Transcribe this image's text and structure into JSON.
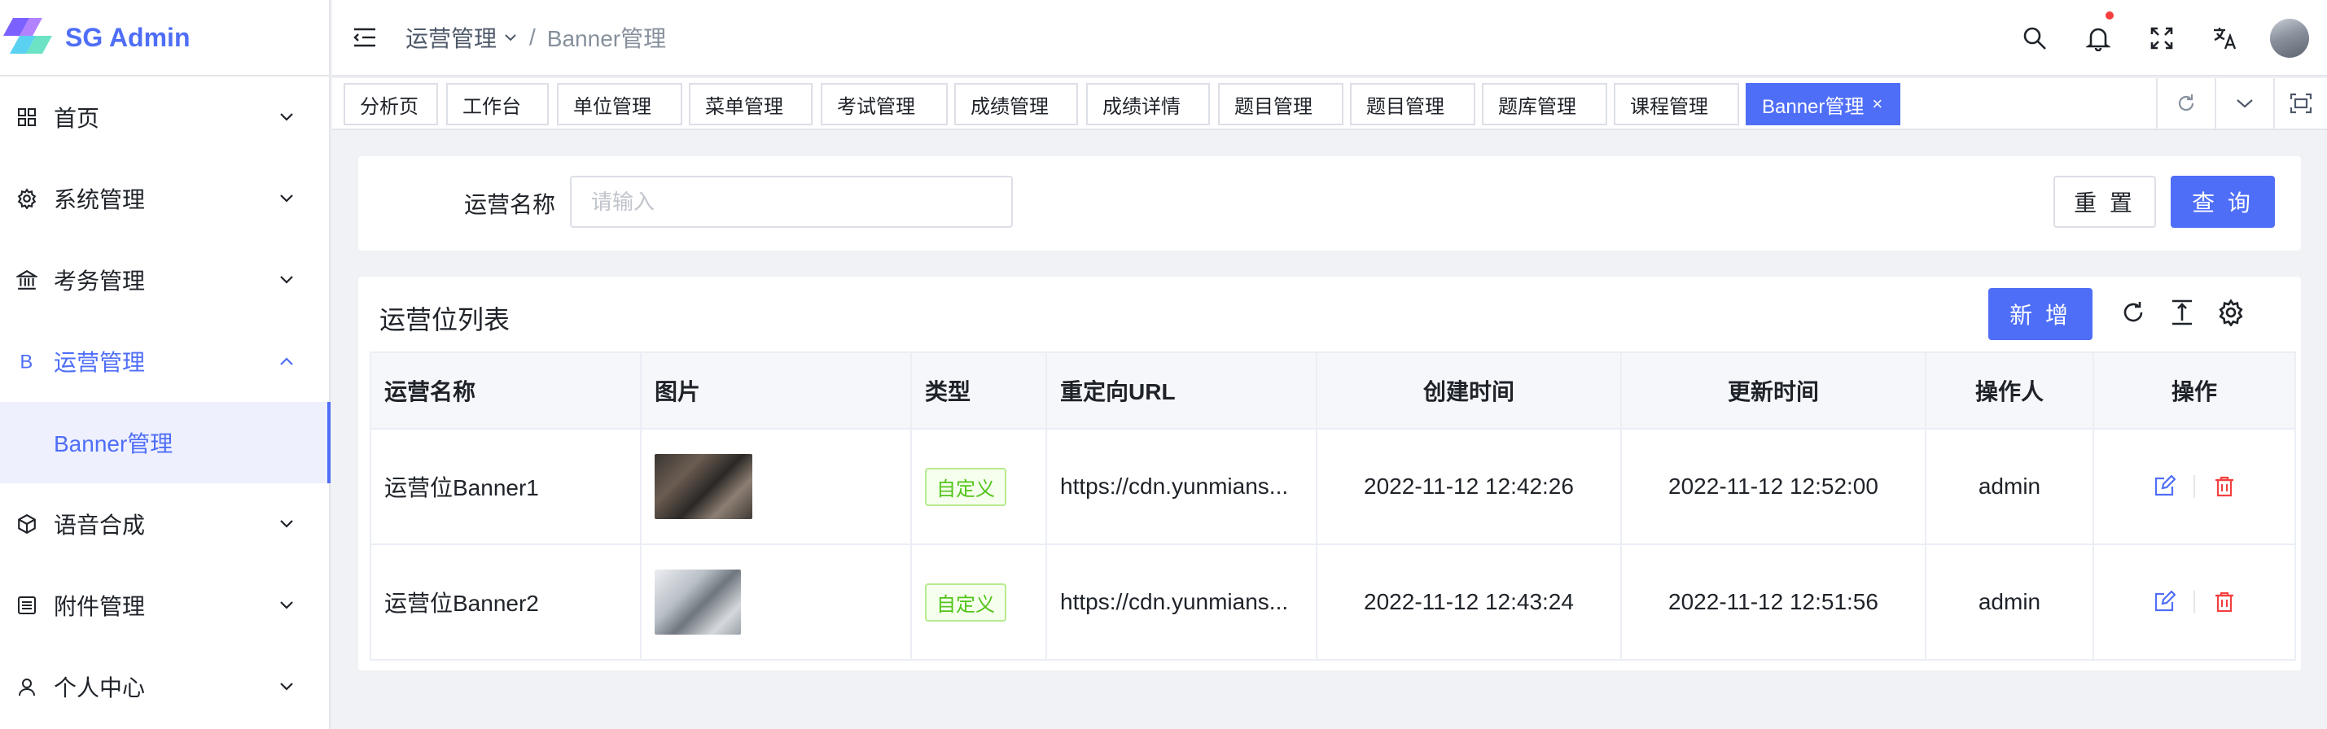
{
  "app": {
    "name": "SG Admin"
  },
  "sidebar": {
    "items": [
      {
        "label": "首页",
        "icon": "dashboard-icon"
      },
      {
        "label": "系统管理",
        "icon": "gear-icon"
      },
      {
        "label": "考务管理",
        "icon": "bank-icon"
      },
      {
        "label": "运营管理",
        "icon": "b-letter-icon",
        "open": true,
        "children": [
          {
            "label": "Banner管理",
            "active": true
          }
        ]
      },
      {
        "label": "语音合成",
        "icon": "cube-icon"
      },
      {
        "label": "附件管理",
        "icon": "list-icon"
      },
      {
        "label": "个人中心",
        "icon": "user-icon"
      }
    ]
  },
  "header": {
    "breadcrumb": [
      "运营管理",
      "Banner管理"
    ],
    "breadcrumb_sep": "/",
    "icons": [
      "search-icon",
      "bell-icon",
      "fullscreen-icon",
      "translate-icon"
    ]
  },
  "tabs": [
    {
      "label": "分析页"
    },
    {
      "label": "工作台"
    },
    {
      "label": "单位管理"
    },
    {
      "label": "菜单管理"
    },
    {
      "label": "考试管理"
    },
    {
      "label": "成绩管理"
    },
    {
      "label": "成绩详情"
    },
    {
      "label": "题目管理"
    },
    {
      "label": "题目管理"
    },
    {
      "label": "题库管理"
    },
    {
      "label": "课程管理"
    },
    {
      "label": "Banner管理",
      "active": true,
      "close": "×"
    }
  ],
  "search": {
    "label": "运营名称",
    "placeholder": "请输入",
    "reset": "重 置",
    "query": "查 询"
  },
  "table": {
    "title": "运营位列表",
    "add": "新 增",
    "columns": [
      "运营名称",
      "图片",
      "类型",
      "重定向URL",
      "创建时间",
      "更新时间",
      "操作人",
      "操作"
    ],
    "rows": [
      {
        "name": "运营位Banner1",
        "type": "自定义",
        "url": "https://cdn.yunmians...",
        "created": "2022-11-12 12:42:26",
        "updated": "2022-11-12 12:52:00",
        "operator": "admin"
      },
      {
        "name": "运营位Banner2",
        "type": "自定义",
        "url": "https://cdn.yunmians...",
        "created": "2022-11-12 12:43:24",
        "updated": "2022-11-12 12:51:56",
        "operator": "admin"
      }
    ]
  },
  "colors": {
    "primary": "#4f6ef7",
    "danger": "#f53f3f",
    "tag_green": "#52c41a"
  }
}
